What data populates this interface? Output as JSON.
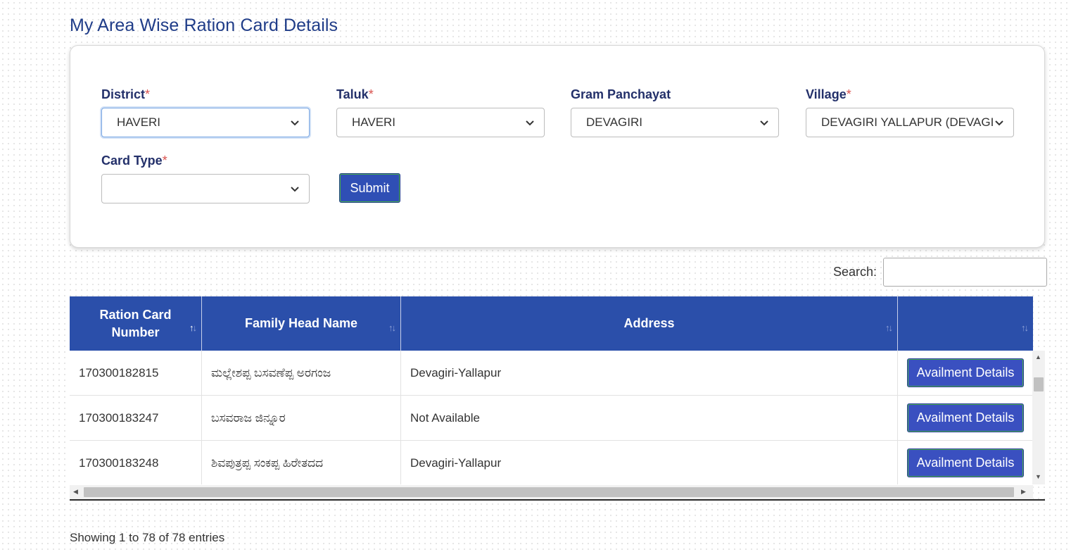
{
  "page_title": "My Area Wise Ration Card Details",
  "filters": {
    "district": {
      "label": "District",
      "required_mark": "*",
      "value": "HAVERI"
    },
    "taluk": {
      "label": "Taluk",
      "required_mark": "*",
      "value": "HAVERI"
    },
    "gram_panchayat": {
      "label": "Gram Panchayat",
      "value": "DEVAGIRI"
    },
    "village": {
      "label": "Village",
      "required_mark": "*",
      "value": "DEVAGIRI YALLAPUR (DEVAGIR"
    },
    "card_type": {
      "label": "Card Type",
      "required_mark": "*",
      "value": ""
    },
    "submit_label": "Submit"
  },
  "search": {
    "label": "Search:",
    "value": ""
  },
  "table": {
    "headers": [
      "Ration Card\nNumber",
      "Family Head Name",
      "Address",
      ""
    ],
    "rows": [
      {
        "card_number": "170300182815",
        "family_head": "ಮಲ್ಲೇಶಪ್ಪ ಬಸವಣೆಪ್ಪ ಅರಗಂಜ",
        "address": "Devagiri-Yallapur",
        "action": "Availment Details"
      },
      {
        "card_number": "170300183247",
        "family_head": "ಬಸವರಾಜ ಜಿನ್ನೂರ",
        "address": "Not Available",
        "action": "Availment Details"
      },
      {
        "card_number": "170300183248",
        "family_head": "ಶಿವಪುತ್ರಪ್ಪ ಸಂಕಪ್ಪ ಹಿರೇತದದ",
        "address": "Devagiri-Yallapur",
        "action": "Availment Details"
      }
    ]
  },
  "info_text": "Showing 1 to 78 of 78 entries",
  "colors": {
    "primary": "#2b4faa",
    "title": "#1f3c88",
    "required": "#d9534f"
  }
}
